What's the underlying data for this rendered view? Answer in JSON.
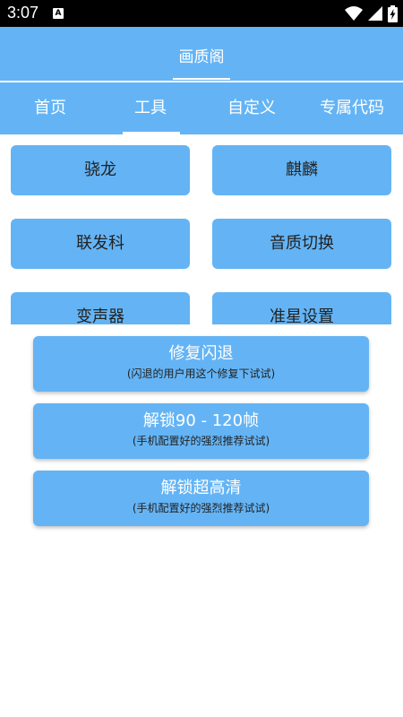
{
  "status_bar": {
    "time": "3:07",
    "notification_icon_letter": "A",
    "icons": [
      "wifi-icon",
      "signal-icon",
      "battery-charging-icon"
    ]
  },
  "app_bar": {
    "title": "画质阁"
  },
  "tabs": [
    {
      "label": "首页",
      "selected": false
    },
    {
      "label": "工具",
      "selected": true
    },
    {
      "label": "自定义",
      "selected": false
    },
    {
      "label": "专属代码",
      "selected": false
    }
  ],
  "grid_buttons": [
    {
      "label": "骁龙"
    },
    {
      "label": "麒麟"
    },
    {
      "label": "联发科"
    },
    {
      "label": "音质切换"
    },
    {
      "label": "变声器"
    },
    {
      "label": "准星设置"
    }
  ],
  "action_buttons": [
    {
      "title": "修复闪退",
      "subtitle": "(闪退的用户用这个修复下试试)"
    },
    {
      "title": "解锁90 - 120帧",
      "subtitle": "(手机配置好的强烈推荐试试)"
    },
    {
      "title": "解锁超高清",
      "subtitle": "(手机配置好的强烈推荐试试)"
    }
  ],
  "colors": {
    "primary": "#64b4f5",
    "status_bar": "#000000",
    "button_text": "#222222",
    "title_text": "#ffffff"
  }
}
